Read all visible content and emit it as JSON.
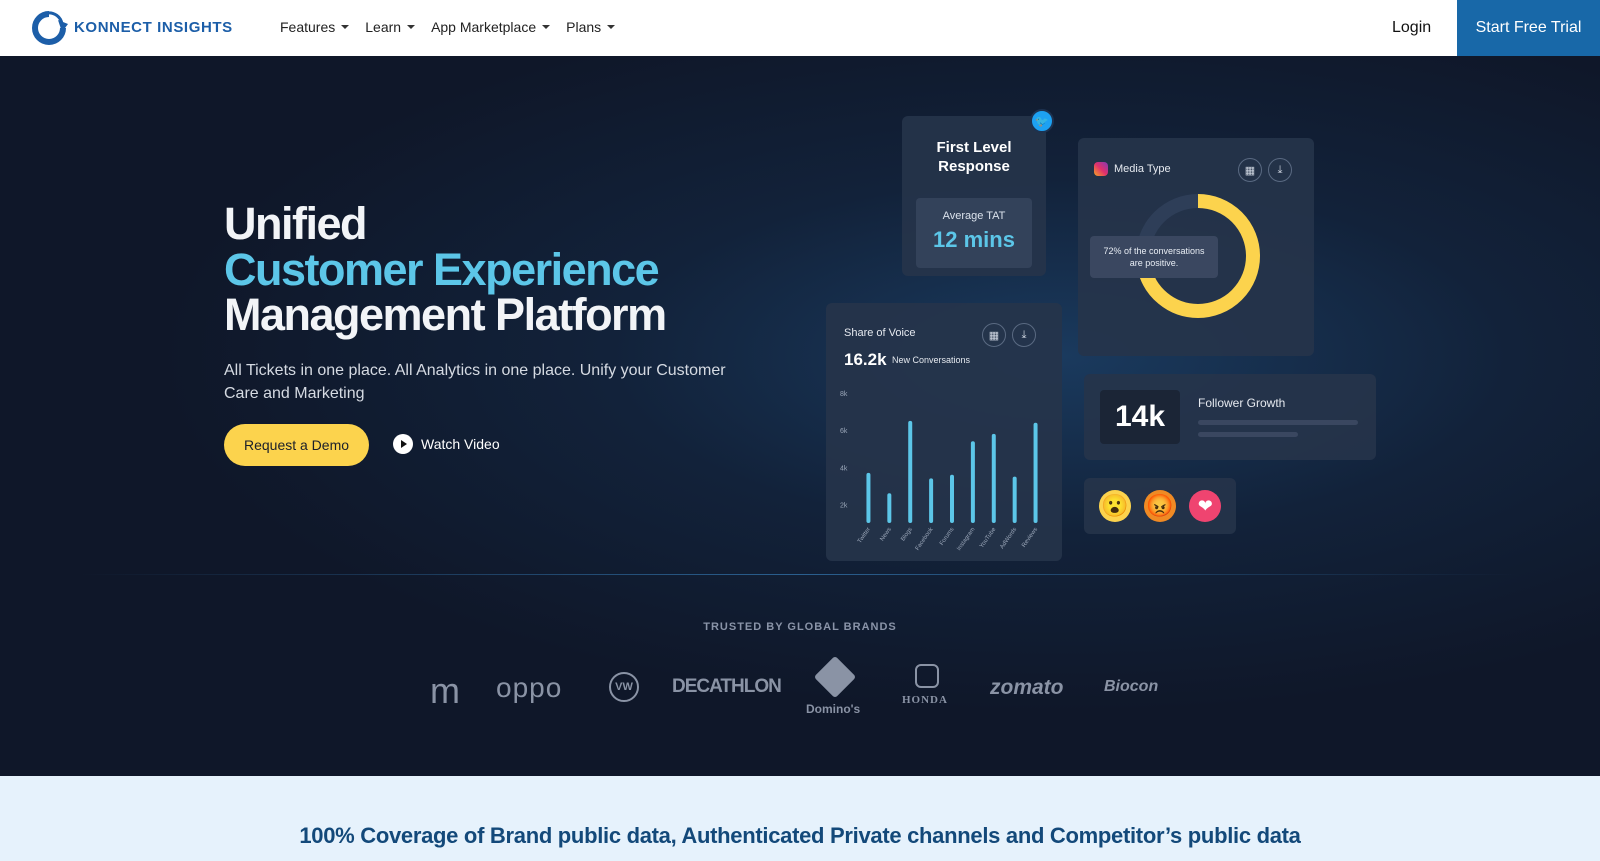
{
  "nav": {
    "logo_text": "KONNECT INSIGHTS",
    "menu": [
      "Features",
      "Learn",
      "App Marketplace",
      "Plans"
    ],
    "login": "Login",
    "cta": "Start Free Trial"
  },
  "hero": {
    "line1": "Unified",
    "line2": "Customer Experience",
    "line3": "Management Platform",
    "subtitle": "All Tickets in one place. All Analytics in one place. Unify your Customer Care and Marketing",
    "demo_button": "Request a Demo",
    "watch_video": "Watch Video"
  },
  "widgets": {
    "first_level": {
      "title": "First Level Response",
      "tat_label": "Average TAT",
      "tat_value": "12 mins"
    },
    "media_type": {
      "title": "Media Type",
      "tooltip": "72% of the conversations are positive.",
      "positive_pct": 72
    },
    "share_of_voice": {
      "title": "Share of Voice",
      "count": "16.2k",
      "count_label": "New Conversations"
    },
    "follower_growth": {
      "value": "14k",
      "label": "Follower Growth"
    },
    "reactions": [
      "😮",
      "😡",
      "❤"
    ]
  },
  "chart_data": {
    "type": "bar",
    "categories": [
      "Twitter",
      "News",
      "Blogs",
      "Facebook",
      "Forums",
      "Instagram",
      "YouTube",
      "AdWords",
      "Reviews"
    ],
    "values": [
      3700,
      2600,
      6500,
      3400,
      3600,
      5400,
      5800,
      3500,
      6400
    ],
    "ylim": [
      1000,
      8000
    ],
    "yticks": [
      "8k",
      "6k",
      "4k",
      "2k"
    ],
    "ytick_values": [
      8000,
      6000,
      4000,
      2000
    ],
    "color": "#5cc6e8"
  },
  "trusted": {
    "label": "TRUSTED BY GLOBAL BRANDS",
    "brands": [
      "m",
      "oppo",
      "VW",
      "DECATHLON",
      "Domino's",
      "HONDA",
      "zomato",
      "Biocon"
    ]
  },
  "bottom": {
    "title": "100% Coverage of Brand public data, Authenticated Private channels and Competitor’s public data"
  },
  "colors": {
    "accent_blue": "#1868a8",
    "cyan": "#5cc6e8",
    "yellow": "#fcd34d",
    "dark_bg": "#0f1729"
  }
}
